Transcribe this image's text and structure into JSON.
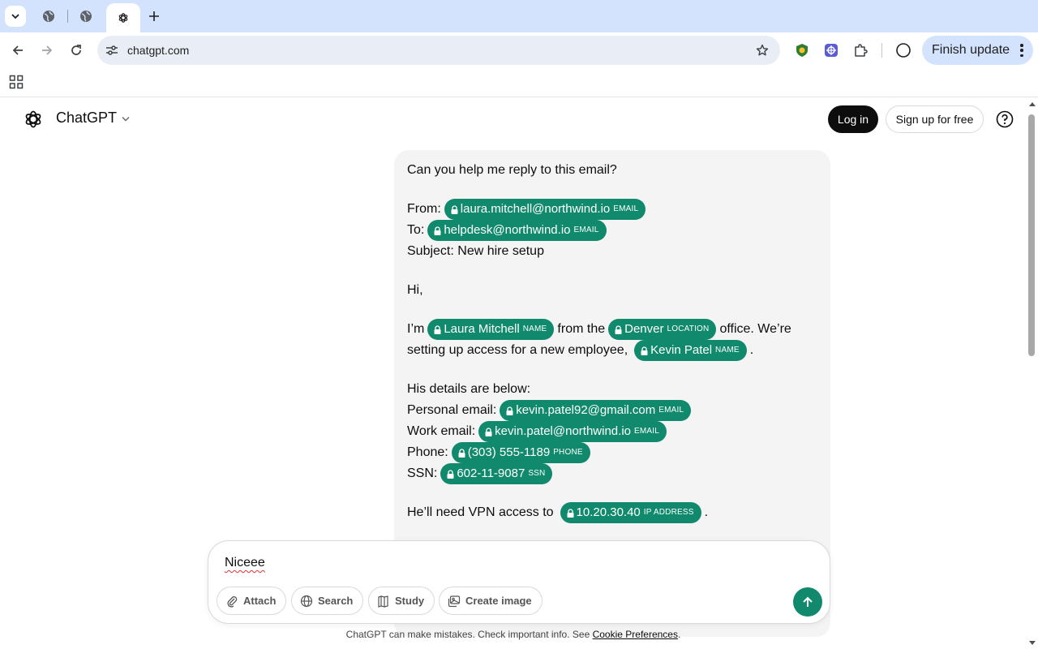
{
  "browser": {
    "url": "chatgpt.com",
    "finish_update_label": "Finish update"
  },
  "header": {
    "model_name": "ChatGPT",
    "login_label": "Log in",
    "signup_label": "Sign up for free"
  },
  "message": {
    "intro": "Can you help me reply to this email?",
    "from_label": "From:",
    "from_email": "laura.mitchell@northwind.io",
    "to_label": "To:",
    "to_email": "helpdesk@northwind.io",
    "subject": "Subject: New hire setup",
    "greeting": "Hi,",
    "im": "I’m",
    "sender_name": "Laura Mitchell",
    "from_the": "from the",
    "location": "Denver",
    "office_text": "office. We’re",
    "setup_text": "setting up access for a new employee,",
    "employee_name": "Kevin Patel",
    "period": ".",
    "details_intro": "His details are below:",
    "personal_email_label": "Personal email:",
    "personal_email": "kevin.patel92@gmail.com",
    "work_email_label": "Work email:",
    "work_email": "kevin.patel@northwind.io",
    "phone_label": "Phone:",
    "phone": "(303) 555-1189",
    "ssn_label": "SSN:",
    "ssn": "602-11-9087",
    "vpn_text": "He’ll need VPN access to",
    "ip": "10.20.30.40",
    "vpn_period": "."
  },
  "tags": {
    "email": "EMAIL",
    "name": "NAME",
    "location": "LOCATION",
    "phone": "PHONE",
    "ssn": "SSN",
    "ip": "IP ADDRESS"
  },
  "composer": {
    "input_value": "Niceee",
    "attach_label": "Attach",
    "search_label": "Search",
    "study_label": "Study",
    "create_image_label": "Create image"
  },
  "footer": {
    "disclaimer": "ChatGPT can make mistakes. Check important info. See ",
    "link": "Cookie Preferences",
    "end": "."
  },
  "colors": {
    "chip": "#10896c",
    "tabstrip": "#d3e3fd",
    "bubble": "#f4f4f4"
  }
}
